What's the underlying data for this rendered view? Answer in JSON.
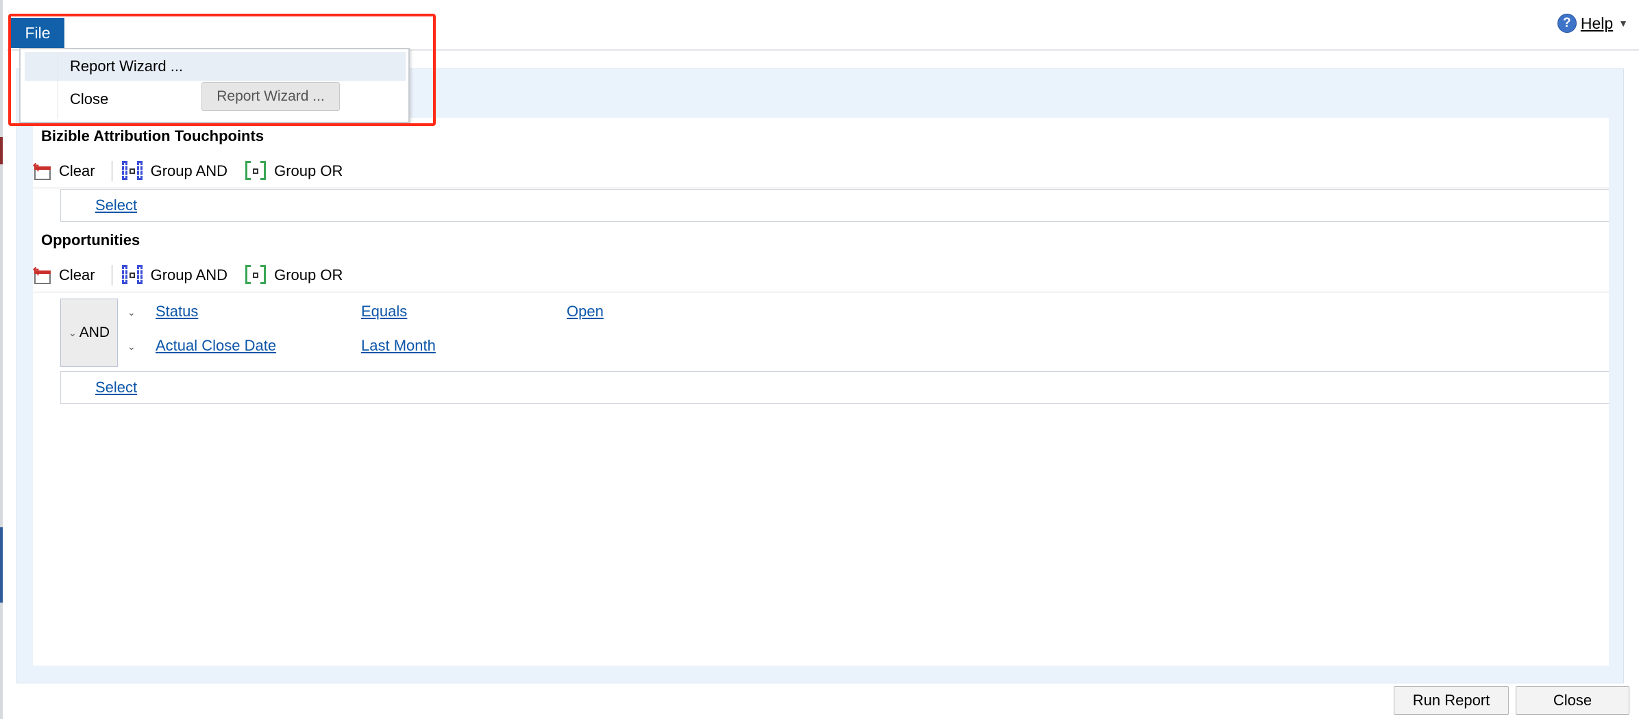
{
  "menubar": {
    "file_label": "File",
    "help_label": "Help",
    "help_icon": "question-circle-icon"
  },
  "file_menu": {
    "items": [
      {
        "label": "Report Wizard ...",
        "highlighted": true
      },
      {
        "label": "Close",
        "highlighted": false
      }
    ],
    "tooltip": "Report Wizard ..."
  },
  "sections": [
    {
      "title": "Bizible Attribution Touchpoints",
      "toolbar": {
        "clear": "Clear",
        "group_and": "Group AND",
        "group_or": "Group OR"
      },
      "select_label": "Select"
    },
    {
      "title": "Opportunities",
      "toolbar": {
        "clear": "Clear",
        "group_and": "Group AND",
        "group_or": "Group OR"
      },
      "group_label": "AND",
      "conditions": [
        {
          "field": "Status",
          "operator": "Equals",
          "value": "Open"
        },
        {
          "field": "Actual Close Date",
          "operator": "Last Month",
          "value": ""
        }
      ],
      "select_label": "Select"
    }
  ],
  "footer": {
    "run_report": "Run Report",
    "close": "Close"
  },
  "colors": {
    "file_tab": "#1160a9",
    "link": "#0b55a8",
    "highlight_border": "#ff2a17",
    "panel_bg": "#eaf2fb"
  }
}
